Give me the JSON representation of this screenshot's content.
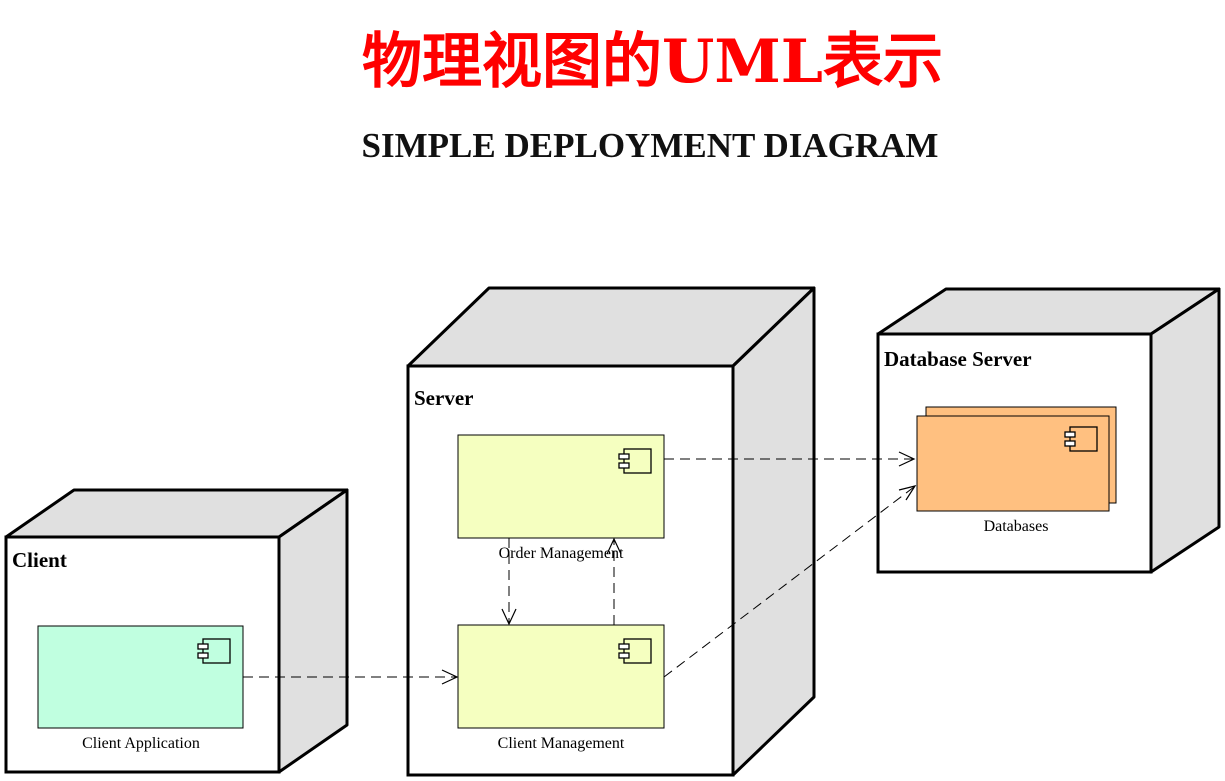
{
  "title": "物理视图的UML表示",
  "subtitle": "SIMPLE DEPLOYMENT DIAGRAM",
  "colors": {
    "title": "#ff0000",
    "node_face": "#ffffff",
    "node_side": "#e0e0e0",
    "client_component": "#c0ffe0",
    "server_component": "#f5ffc0",
    "database_component": "#ffc080"
  },
  "nodes": {
    "client": {
      "label": "Client",
      "component": "Client Application"
    },
    "server": {
      "label": "Server",
      "components": [
        "Order Management",
        "Client Management"
      ]
    },
    "database_server": {
      "label": "Database Server",
      "component": "Databases"
    }
  },
  "icons": {
    "component": "uml-component-icon",
    "dependency": "dashed-arrow"
  }
}
